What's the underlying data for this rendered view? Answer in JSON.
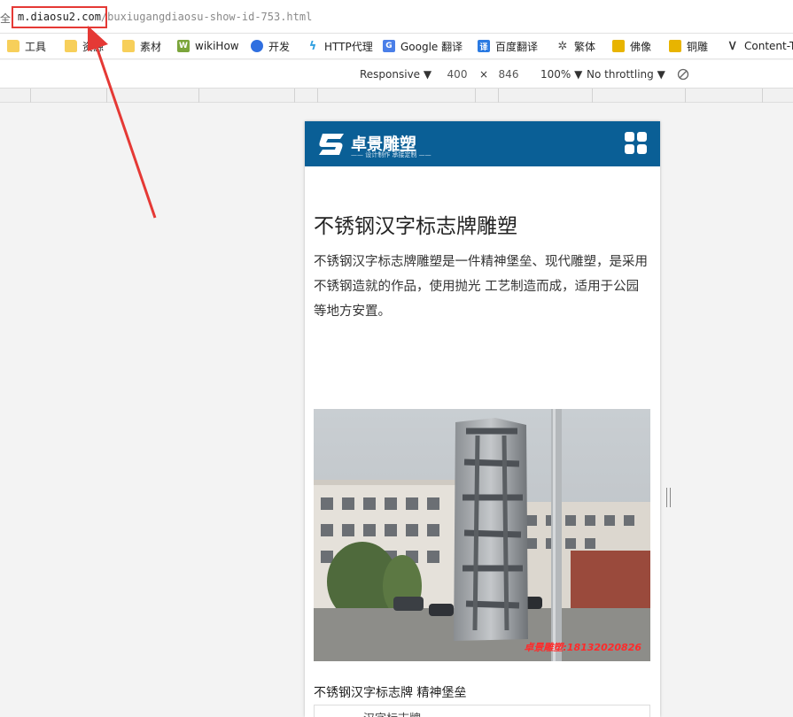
{
  "browser": {
    "address_lead": "全",
    "url_domain": "m.diaosu2.com",
    "url_path": "/buxiugangdiaosu-show-id-753.html",
    "bookmarks": [
      {
        "icon": "folder-icon",
        "label": "工具"
      },
      {
        "icon": "folder-icon",
        "label": "资源"
      },
      {
        "icon": "folder-icon",
        "label": "素材"
      },
      {
        "icon": "wikihow-icon",
        "label": "wikiHow"
      },
      {
        "icon": "paw-icon",
        "label": "开发"
      },
      {
        "icon": "proxy-icon",
        "label": "HTTP代理"
      },
      {
        "icon": "google-translate-icon",
        "label": "Google 翻译"
      },
      {
        "icon": "baidu-translate-icon",
        "label": "百度翻译"
      },
      {
        "icon": "traditional-icon",
        "label": "繁体"
      },
      {
        "icon": "buddha-icon",
        "label": "佛像"
      },
      {
        "icon": "bronze-icon",
        "label": "铜雕"
      },
      {
        "icon": "content-icon",
        "label": "Content-T"
      }
    ]
  },
  "devtools": {
    "device": "Responsive ▼",
    "width": "400",
    "times": "×",
    "height": "846",
    "zoom": "100% ▼",
    "throttle": "No throttling ▼"
  },
  "site": {
    "logo_name": "卓景",
    "logo_name_bold": "雕塑",
    "logo_slogan": "—— 设计制作 承接定制 ——"
  },
  "article": {
    "title": "不锈钢汉字标志牌雕塑",
    "description": "不锈钢汉字标志牌雕塑是一件精神堡垒、现代雕塑，是采用不锈钢造就的作品，使用抛光 工艺制造而成，适用于公园等地方安置。",
    "photo_watermark": "卓景雕塑:18132020826",
    "caption": "不锈钢汉字标志牌 精神堡垒",
    "table_fragment": "汉字标志牌"
  },
  "colors": {
    "site_header": "#0a5f96",
    "annotation_red": "#e53935"
  }
}
